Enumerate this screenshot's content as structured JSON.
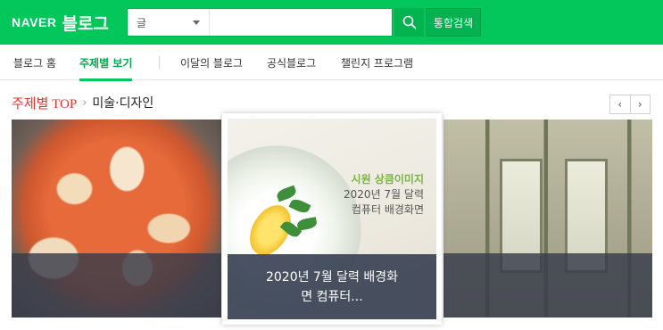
{
  "header": {
    "logo_naver": "NAVER",
    "logo_blog": "블로그",
    "search": {
      "category": "글",
      "placeholder": "",
      "value": ""
    },
    "search_button_icon": "search-icon",
    "total_search_label": "통합검색",
    "accent_color": "#03c75a"
  },
  "nav": {
    "items": [
      {
        "label": "블로그 홈",
        "active": false
      },
      {
        "label": "주제별 보기",
        "active": true
      },
      {
        "label": "이달의 블로그",
        "active": false
      },
      {
        "label": "공식블로그",
        "active": false
      },
      {
        "label": "챌린지 프로그램",
        "active": false
      }
    ]
  },
  "breadcrumb": {
    "top": "주제별 TOP",
    "separator": "›",
    "current": "미술·디자인"
  },
  "pager": {
    "prev": "‹",
    "next": "›"
  },
  "featured": {
    "image_text_line1": "시원 상큼이미지",
    "image_text_line2": "2020년 7월 달력",
    "image_text_line3": "컴퓨터 배경화면",
    "caption_line1": "2020년 7월 달력 배경화",
    "caption_line2": "면 컴퓨터..."
  }
}
